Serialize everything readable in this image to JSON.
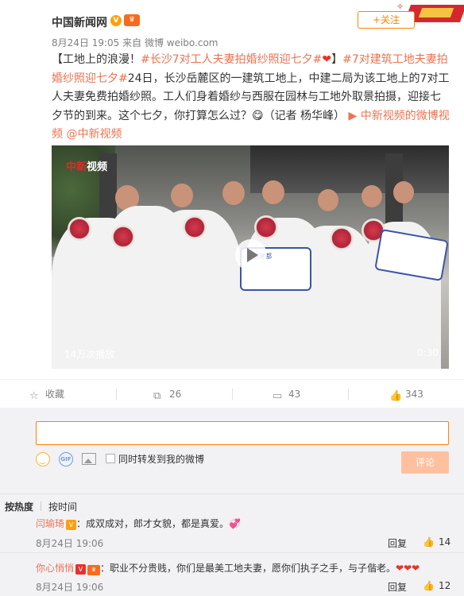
{
  "post": {
    "author": "中国新闻网",
    "verify_badge": "V",
    "vip_badge": "会员",
    "timestamp": "8月24日 19:05",
    "source": "来自 微博 weibo.com",
    "follow_label": "+关注",
    "text": {
      "p1": "【工地上的浪漫！",
      "tag1": "#长沙7对工人夫妻拍婚纱照迎七夕#",
      "heart": "❤",
      "p2": "】",
      "tag2": "#7对建筑工地夫妻拍婚纱照迎七夕#",
      "p3": "24日，长沙岳麓区的一建筑工地上，中建二局为该工地上的7对工人夫妻免费拍婚纱照。工人们身着婚纱与西服在园林与工地外取景拍摄，迎接七夕节的到来。这个七夕，你打算怎么过？",
      "emoji": "😋",
      "p4": "（记者 杨华峰）",
      "link1": "中新视频的微博视频",
      "link2": "@中新视频"
    },
    "video": {
      "logo_a": "中新",
      "logo_b": "视频",
      "play_count": "14万次播放",
      "duration": "0:30",
      "sign_text": "中国建都"
    }
  },
  "actions": {
    "favorite": "收藏",
    "repost": "26",
    "comment": "43",
    "like": "343"
  },
  "comment_box": {
    "placeholder": "",
    "repost_label": "同时转发到我的微博",
    "submit_label": "评论"
  },
  "sort": {
    "hot": "按热度",
    "time": "按时间"
  },
  "comments": [
    {
      "author": "闫瑜琦",
      "text": "：成双成对，郎才女貌，都是真爱。",
      "time": "8月24日 19:06",
      "reply": "回复",
      "likes": "14"
    },
    {
      "author": "你心悄悄",
      "text": "：职业不分贵贱，你们是最美工地夫妻，愿你们执子之手，与子偕老。",
      "hearts": "❤❤❤",
      "time": "8月24日 19:06",
      "reply": "回复",
      "likes": "12"
    }
  ]
}
